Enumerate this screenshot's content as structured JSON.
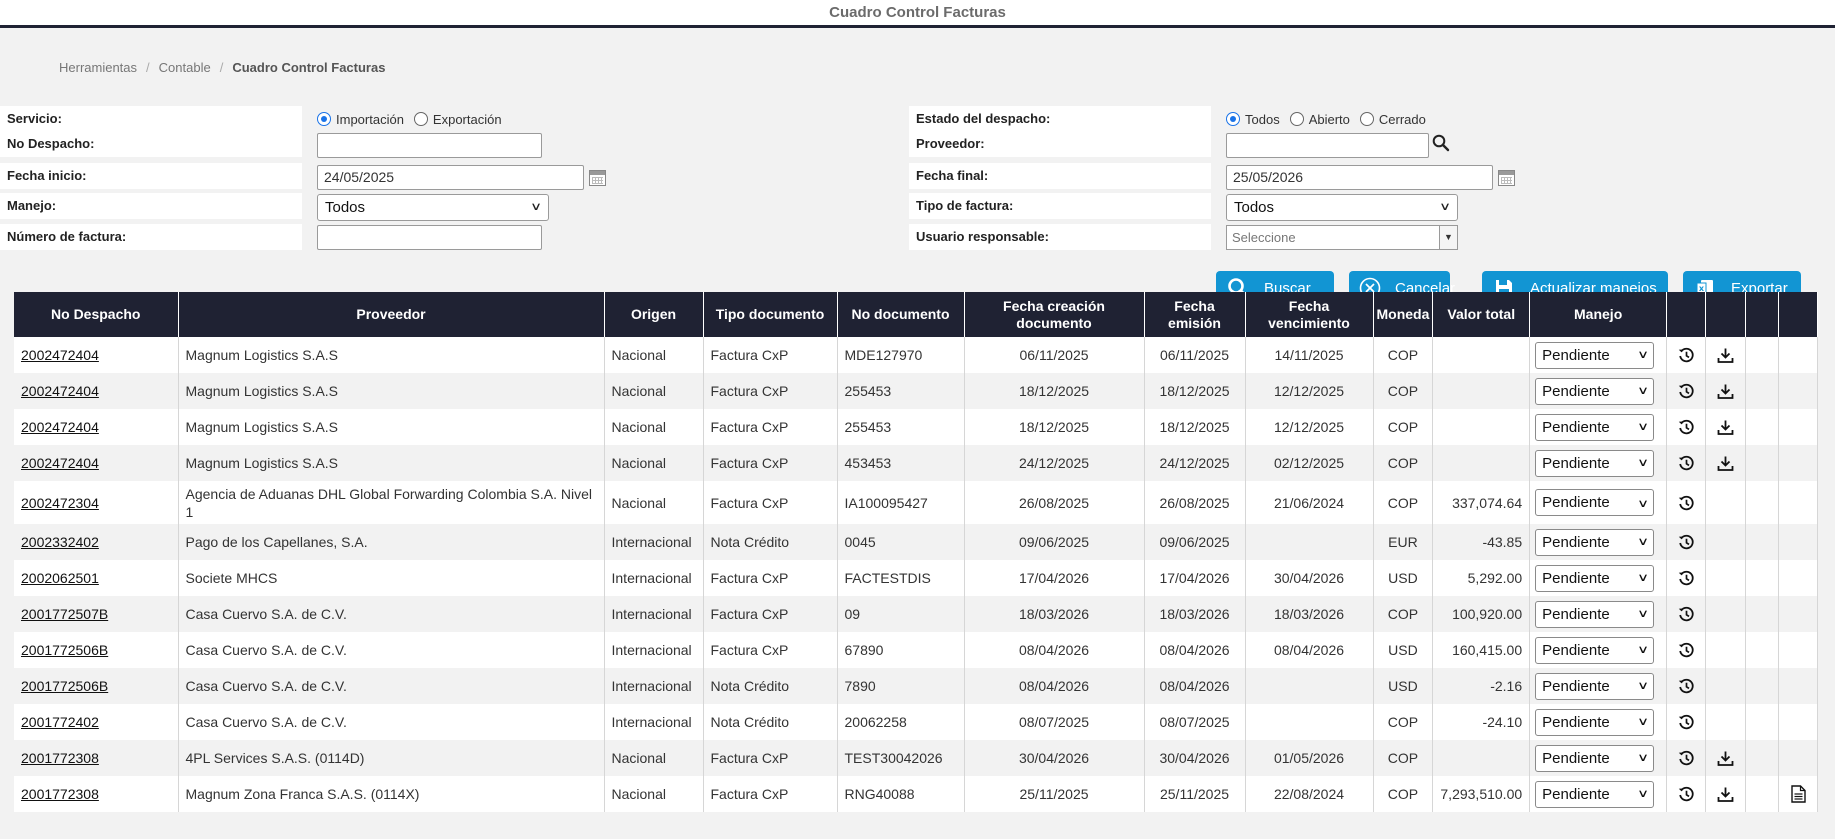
{
  "page_title": "Cuadro Control Facturas",
  "breadcrumb": [
    "Herramientas",
    "Contable",
    "Cuadro Control Facturas"
  ],
  "filters": {
    "servicio_label": "Servicio:",
    "servicio_options": [
      "Importación",
      "Exportación"
    ],
    "servicio_selected": "Importación",
    "no_despacho_label": "No Despacho:",
    "no_despacho_value": "",
    "fecha_inicio_label": "Fecha inicio:",
    "fecha_inicio_value": "24/05/2025",
    "manejo_label": "Manejo:",
    "manejo_value": "Todos",
    "numero_factura_label": "Número de factura:",
    "numero_factura_value": "",
    "estado_label": "Estado del despacho:",
    "estado_options": [
      "Todos",
      "Abierto",
      "Cerrado"
    ],
    "estado_selected": "Todos",
    "proveedor_label": "Proveedor:",
    "proveedor_value": "",
    "fecha_final_label": "Fecha final:",
    "fecha_final_value": "25/05/2026",
    "tipo_factura_label": "Tipo de factura:",
    "tipo_factura_value": "Todos",
    "usuario_label": "Usuario responsable:",
    "usuario_placeholder": "Seleccione"
  },
  "actions": {
    "buscar": "Buscar",
    "cancelar": "Cancelar",
    "actualizar": "Actualizar manejos",
    "exportar": "Exportar"
  },
  "colors": {
    "header_bg": "#1f2233",
    "button_bg": "#1295d3",
    "radio_accent": "#1a73e8"
  },
  "table": {
    "headers": [
      "No Despacho",
      "Proveedor",
      "Origen",
      "Tipo documento",
      "No documento",
      "Fecha creación documento",
      "Fecha emisión",
      "Fecha vencimiento",
      "Moneda",
      "Valor total",
      "Manejo",
      "",
      "",
      "",
      ""
    ],
    "rows": [
      {
        "despacho": "2002472404",
        "proveedor": "Magnum Logistics S.A.S",
        "origen": "Nacional",
        "tipo": "Factura CxP",
        "documento": "MDE127970",
        "creacion": "06/11/2025",
        "emision": "06/11/2025",
        "vencimiento": "14/11/2025",
        "moneda": "COP",
        "valor": "",
        "manejo": "Pendiente",
        "history": true,
        "download": true,
        "doc": false
      },
      {
        "despacho": "2002472404",
        "proveedor": "Magnum Logistics S.A.S",
        "origen": "Nacional",
        "tipo": "Factura CxP",
        "documento": "255453",
        "creacion": "18/12/2025",
        "emision": "18/12/2025",
        "vencimiento": "12/12/2025",
        "moneda": "COP",
        "valor": "",
        "manejo": "Pendiente",
        "history": true,
        "download": true,
        "doc": false
      },
      {
        "despacho": "2002472404",
        "proveedor": "Magnum Logistics S.A.S",
        "origen": "Nacional",
        "tipo": "Factura CxP",
        "documento": "255453",
        "creacion": "18/12/2025",
        "emision": "18/12/2025",
        "vencimiento": "12/12/2025",
        "moneda": "COP",
        "valor": "",
        "manejo": "Pendiente",
        "history": true,
        "download": true,
        "doc": false
      },
      {
        "despacho": "2002472404",
        "proveedor": "Magnum Logistics S.A.S",
        "origen": "Nacional",
        "tipo": "Factura CxP",
        "documento": "453453",
        "creacion": "24/12/2025",
        "emision": "24/12/2025",
        "vencimiento": "02/12/2025",
        "moneda": "COP",
        "valor": "",
        "manejo": "Pendiente",
        "history": true,
        "download": true,
        "doc": false
      },
      {
        "despacho": "2002472304",
        "proveedor": "Agencia de Aduanas DHL Global Forwarding Colombia S.A. Nivel 1",
        "origen": "Nacional",
        "tipo": "Factura CxP",
        "documento": "IA100095427",
        "creacion": "26/08/2025",
        "emision": "26/08/2025",
        "vencimiento": "21/06/2024",
        "moneda": "COP",
        "valor": "337,074.64",
        "manejo": "Pendiente",
        "history": true,
        "download": false,
        "doc": false
      },
      {
        "despacho": "2002332402",
        "proveedor": "Pago de los Capellanes, S.A.",
        "origen": "Internacional",
        "tipo": "Nota Crédito",
        "documento": "0045",
        "creacion": "09/06/2025",
        "emision": "09/06/2025",
        "vencimiento": "",
        "moneda": "EUR",
        "valor": "-43.85",
        "manejo": "Pendiente",
        "history": true,
        "download": false,
        "doc": false
      },
      {
        "despacho": "2002062501",
        "proveedor": "Societe MHCS",
        "origen": "Internacional",
        "tipo": "Factura CxP",
        "documento": "FACTESTDIS",
        "creacion": "17/04/2026",
        "emision": "17/04/2026",
        "vencimiento": "30/04/2026",
        "moneda": "USD",
        "valor": "5,292.00",
        "manejo": "Pendiente",
        "history": true,
        "download": false,
        "doc": false
      },
      {
        "despacho": "2001772507B",
        "proveedor": "Casa Cuervo S.A. de C.V.",
        "origen": "Internacional",
        "tipo": "Factura CxP",
        "documento": "09",
        "creacion": "18/03/2026",
        "emision": "18/03/2026",
        "vencimiento": "18/03/2026",
        "moneda": "COP",
        "valor": "100,920.00",
        "manejo": "Pendiente",
        "history": true,
        "download": false,
        "doc": false
      },
      {
        "despacho": "2001772506B",
        "proveedor": "Casa Cuervo S.A. de C.V.",
        "origen": "Internacional",
        "tipo": "Factura CxP",
        "documento": "67890",
        "creacion": "08/04/2026",
        "emision": "08/04/2026",
        "vencimiento": "08/04/2026",
        "moneda": "USD",
        "valor": "160,415.00",
        "manejo": "Pendiente",
        "history": true,
        "download": false,
        "doc": false
      },
      {
        "despacho": "2001772506B",
        "proveedor": "Casa Cuervo S.A. de C.V.",
        "origen": "Internacional",
        "tipo": "Nota Crédito",
        "documento": "7890",
        "creacion": "08/04/2026",
        "emision": "08/04/2026",
        "vencimiento": "",
        "moneda": "USD",
        "valor": "-2.16",
        "manejo": "Pendiente",
        "history": true,
        "download": false,
        "doc": false
      },
      {
        "despacho": "2001772402",
        "proveedor": "Casa Cuervo S.A. de C.V.",
        "origen": "Internacional",
        "tipo": "Nota Crédito",
        "documento": "20062258",
        "creacion": "08/07/2025",
        "emision": "08/07/2025",
        "vencimiento": "",
        "moneda": "COP",
        "valor": "-24.10",
        "manejo": "Pendiente",
        "history": true,
        "download": false,
        "doc": false
      },
      {
        "despacho": "2001772308",
        "proveedor": "4PL Services S.A.S. (0114D)",
        "origen": "Nacional",
        "tipo": "Factura CxP",
        "documento": "TEST30042026",
        "creacion": "30/04/2026",
        "emision": "30/04/2026",
        "vencimiento": "01/05/2026",
        "moneda": "COP",
        "valor": "",
        "manejo": "Pendiente",
        "history": true,
        "download": true,
        "doc": false
      },
      {
        "despacho": "2001772308",
        "proveedor": "Magnum Zona Franca S.A.S. (0114X)",
        "origen": "Nacional",
        "tipo": "Factura CxP",
        "documento": "RNG40088",
        "creacion": "25/11/2025",
        "emision": "25/11/2025",
        "vencimiento": "22/08/2024",
        "moneda": "COP",
        "valor": "7,293,510.00",
        "manejo": "Pendiente",
        "history": true,
        "download": true,
        "doc": true
      }
    ]
  }
}
